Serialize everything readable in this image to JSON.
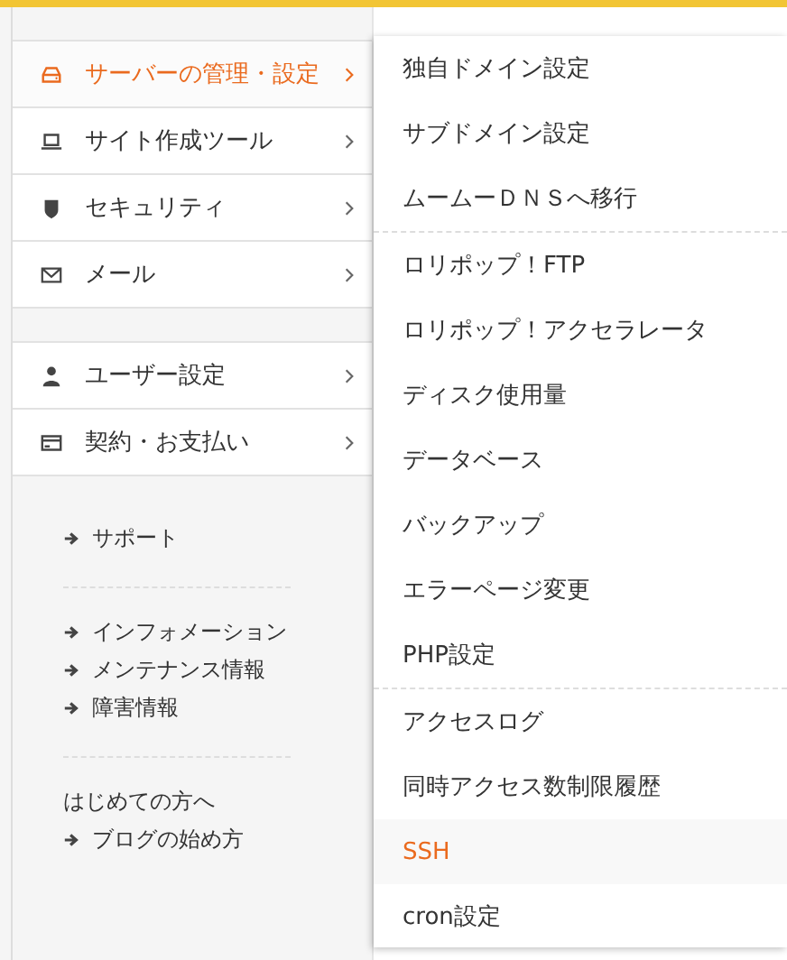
{
  "sidebar": {
    "groups": [
      {
        "items": [
          {
            "label": "サーバーの管理・設定",
            "selected": true
          },
          {
            "label": "サイト作成ツール",
            "selected": false
          },
          {
            "label": "セキュリティ",
            "selected": false
          },
          {
            "label": "メール",
            "selected": false
          }
        ]
      },
      {
        "items": [
          {
            "label": "ユーザー設定",
            "selected": false
          },
          {
            "label": "契約・お支払い",
            "selected": false
          }
        ]
      }
    ]
  },
  "links": {
    "groups": [
      {
        "items": [
          "サポート"
        ]
      },
      {
        "items": [
          "インフォメーション",
          "メンテナンス情報",
          "障害情報"
        ]
      },
      {
        "heading": "はじめての方へ",
        "items": [
          "ブログの始め方"
        ]
      }
    ]
  },
  "submenu": {
    "sections": [
      {
        "items": [
          {
            "label": "独自ドメイン設定",
            "selected": false
          },
          {
            "label": "サブドメイン設定",
            "selected": false
          },
          {
            "label": "ムームーＤＮＳへ移行",
            "selected": false
          }
        ]
      },
      {
        "items": [
          {
            "label": "ロリポップ！FTP",
            "selected": false
          },
          {
            "label": "ロリポップ！アクセラレータ",
            "selected": false
          },
          {
            "label": "ディスク使用量",
            "selected": false
          },
          {
            "label": "データベース",
            "selected": false
          },
          {
            "label": "バックアップ",
            "selected": false
          },
          {
            "label": "エラーページ変更",
            "selected": false
          },
          {
            "label": "PHP設定",
            "selected": false
          }
        ]
      },
      {
        "items": [
          {
            "label": "アクセスログ",
            "selected": false
          },
          {
            "label": "同時アクセス数制限履歴",
            "selected": false
          },
          {
            "label": "SSH",
            "selected": true
          },
          {
            "label": "cron設定",
            "selected": false
          }
        ]
      }
    ]
  }
}
